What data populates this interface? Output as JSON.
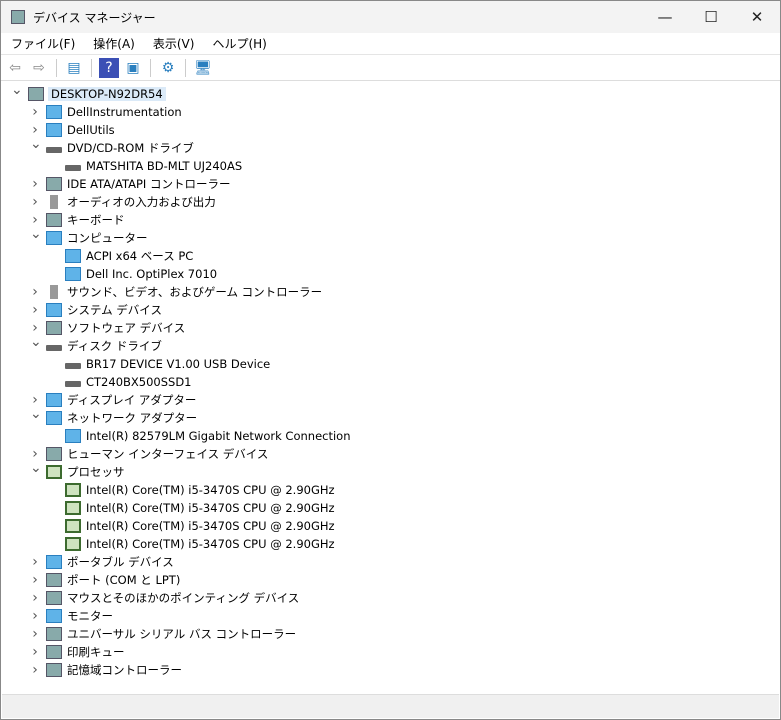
{
  "window": {
    "title": "デバイス マネージャー",
    "minimize": "—",
    "maximize": "☐",
    "close": "✕"
  },
  "menu": [
    "ファイル(F)",
    "操作(A)",
    "表示(V)",
    "ヘルプ(H)"
  ],
  "toolbar": [
    {
      "name": "back",
      "glyph": "⇦"
    },
    {
      "name": "forward",
      "glyph": "⇨"
    },
    {
      "name": "properties",
      "glyph": "▤"
    },
    {
      "name": "help",
      "glyph": "?"
    },
    {
      "name": "show-hidden",
      "glyph": "▣"
    },
    {
      "name": "update-driver",
      "glyph": "⚙"
    },
    {
      "name": "scan-hardware",
      "glyph": "🖥"
    }
  ],
  "tree": [
    {
      "level": 0,
      "label": "DESKTOP-N92DR54",
      "state": "open",
      "icon": "computer"
    },
    {
      "level": 1,
      "label": "DellInstrumentation",
      "state": "closed",
      "icon": "net"
    },
    {
      "level": 1,
      "label": "DellUtils",
      "state": "closed",
      "icon": "net"
    },
    {
      "level": 1,
      "label": "DVD/CD-ROM ドライブ",
      "state": "open",
      "icon": "drive"
    },
    {
      "level": 2,
      "label": "MATSHITA BD-MLT UJ240AS",
      "icon": "drive"
    },
    {
      "level": 1,
      "label": "IDE ATA/ATAPI コントローラー",
      "state": "closed",
      "icon": "gen"
    },
    {
      "level": 1,
      "label": "オーディオの入力および出力",
      "state": "closed",
      "icon": "speaker"
    },
    {
      "level": 1,
      "label": "キーボード",
      "state": "closed",
      "icon": "gen"
    },
    {
      "level": 1,
      "label": "コンピューター",
      "state": "open",
      "icon": "monitor"
    },
    {
      "level": 2,
      "label": "ACPI x64 ベース PC",
      "icon": "monitor"
    },
    {
      "level": 2,
      "label": "Dell Inc. OptiPlex 7010",
      "icon": "monitor"
    },
    {
      "level": 1,
      "label": "サウンド、ビデオ、およびゲーム コントローラー",
      "state": "closed",
      "icon": "speaker"
    },
    {
      "level": 1,
      "label": "システム デバイス",
      "state": "closed",
      "icon": "monitor"
    },
    {
      "level": 1,
      "label": "ソフトウェア デバイス",
      "state": "closed",
      "icon": "gen"
    },
    {
      "level": 1,
      "label": "ディスク ドライブ",
      "state": "open",
      "icon": "drive"
    },
    {
      "level": 2,
      "label": "BR17  DEVICE V1.00 USB Device",
      "icon": "drive"
    },
    {
      "level": 2,
      "label": "CT240BX500SSD1",
      "icon": "drive"
    },
    {
      "level": 1,
      "label": "ディスプレイ アダプター",
      "state": "closed",
      "icon": "monitor"
    },
    {
      "level": 1,
      "label": "ネットワーク アダプター",
      "state": "open",
      "icon": "net"
    },
    {
      "level": 2,
      "label": "Intel(R) 82579LM Gigabit Network Connection",
      "icon": "net"
    },
    {
      "level": 1,
      "label": "ヒューマン インターフェイス デバイス",
      "state": "closed",
      "icon": "gen"
    },
    {
      "level": 1,
      "label": "プロセッサ",
      "state": "open",
      "icon": "cpu"
    },
    {
      "level": 2,
      "label": "Intel(R) Core(TM) i5-3470S CPU @ 2.90GHz",
      "icon": "cpu"
    },
    {
      "level": 2,
      "label": "Intel(R) Core(TM) i5-3470S CPU @ 2.90GHz",
      "icon": "cpu"
    },
    {
      "level": 2,
      "label": "Intel(R) Core(TM) i5-3470S CPU @ 2.90GHz",
      "icon": "cpu"
    },
    {
      "level": 2,
      "label": "Intel(R) Core(TM) i5-3470S CPU @ 2.90GHz",
      "icon": "cpu"
    },
    {
      "level": 1,
      "label": "ポータブル デバイス",
      "state": "closed",
      "icon": "monitor"
    },
    {
      "level": 1,
      "label": "ポート (COM と LPT)",
      "state": "closed",
      "icon": "gen"
    },
    {
      "level": 1,
      "label": "マウスとそのほかのポインティング デバイス",
      "state": "closed",
      "icon": "gen"
    },
    {
      "level": 1,
      "label": "モニター",
      "state": "closed",
      "icon": "monitor"
    },
    {
      "level": 1,
      "label": "ユニバーサル シリアル バス コントローラー",
      "state": "closed",
      "icon": "gen"
    },
    {
      "level": 1,
      "label": "印刷キュー",
      "state": "closed",
      "icon": "gen"
    },
    {
      "level": 1,
      "label": "記憶域コントローラー",
      "state": "closed",
      "icon": "gen"
    }
  ]
}
